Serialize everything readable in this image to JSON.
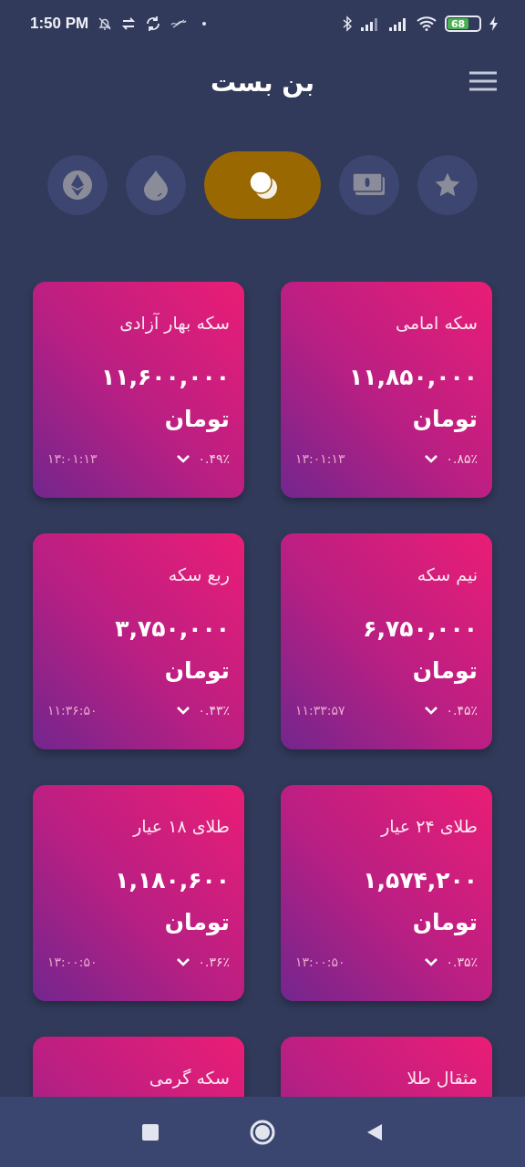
{
  "status_bar": {
    "time": "1:50 PM",
    "battery": "68"
  },
  "header": {
    "title": "بن بست"
  },
  "tabs": [
    {
      "kind": "star",
      "selected": false
    },
    {
      "kind": "cash",
      "selected": false
    },
    {
      "kind": "coins",
      "selected": true
    },
    {
      "kind": "drop",
      "selected": false
    },
    {
      "kind": "ethereum",
      "selected": false
    }
  ],
  "cards": [
    {
      "title": "سکه امامی",
      "price": "۱۱,۸۵۰,۰۰۰ تومان",
      "change": "۰.۸۵٪",
      "falling": true,
      "time": "۱۳:۰۱:۱۳"
    },
    {
      "title": "سکه بهار آزادی",
      "price": "۱۱,۶۰۰,۰۰۰ تومان",
      "change": "۰.۴۹٪",
      "falling": true,
      "time": "۱۳:۰۱:۱۳"
    },
    {
      "title": "نیم سکه",
      "price": "۶,۷۵۰,۰۰۰ تومان",
      "change": "۰.۴۵٪",
      "falling": true,
      "time": "۱۱:۳۳:۵۷"
    },
    {
      "title": "ربع سکه",
      "price": "۳,۷۵۰,۰۰۰ تومان",
      "change": "۰.۴۳٪",
      "falling": true,
      "time": "۱۱:۳۶:۵۰"
    },
    {
      "title": "طلای ۲۴ عیار",
      "price": "۱,۵۷۴,۲۰۰ تومان",
      "change": "۰.۳۵٪",
      "falling": true,
      "time": "۱۳:۰۰:۵۰"
    },
    {
      "title": "طلای ۱۸ عیار",
      "price": "۱,۱۸۰,۶۰۰ تومان",
      "change": "۰.۳۶٪",
      "falling": true,
      "time": "۱۳:۰۰:۵۰"
    },
    {
      "title": "مثقال طلا"
    },
    {
      "title": "سکه گرمی"
    }
  ]
}
